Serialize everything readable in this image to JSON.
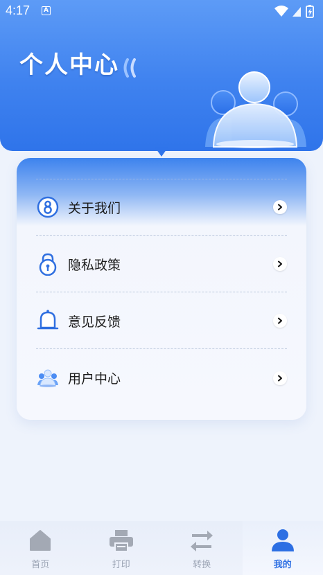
{
  "status_bar": {
    "time": "4:17",
    "notification_badge": "A"
  },
  "header": {
    "title": "个人中心"
  },
  "menu": [
    {
      "label": "关于我们",
      "icon": "about-icon"
    },
    {
      "label": "隐私政策",
      "icon": "lock-icon"
    },
    {
      "label": "意见反馈",
      "icon": "bell-icon"
    },
    {
      "label": "用户中心",
      "icon": "users-icon"
    }
  ],
  "bottom_nav": [
    {
      "label": "首页",
      "icon": "home-icon",
      "active": false
    },
    {
      "label": "打印",
      "icon": "printer-icon",
      "active": false
    },
    {
      "label": "转换",
      "icon": "convert-icon",
      "active": false
    },
    {
      "label": "我的",
      "icon": "user-icon",
      "active": true
    }
  ],
  "colors": {
    "accent": "#2f74ea",
    "inactive": "#9aa3b3",
    "background": "#eef3fc"
  }
}
